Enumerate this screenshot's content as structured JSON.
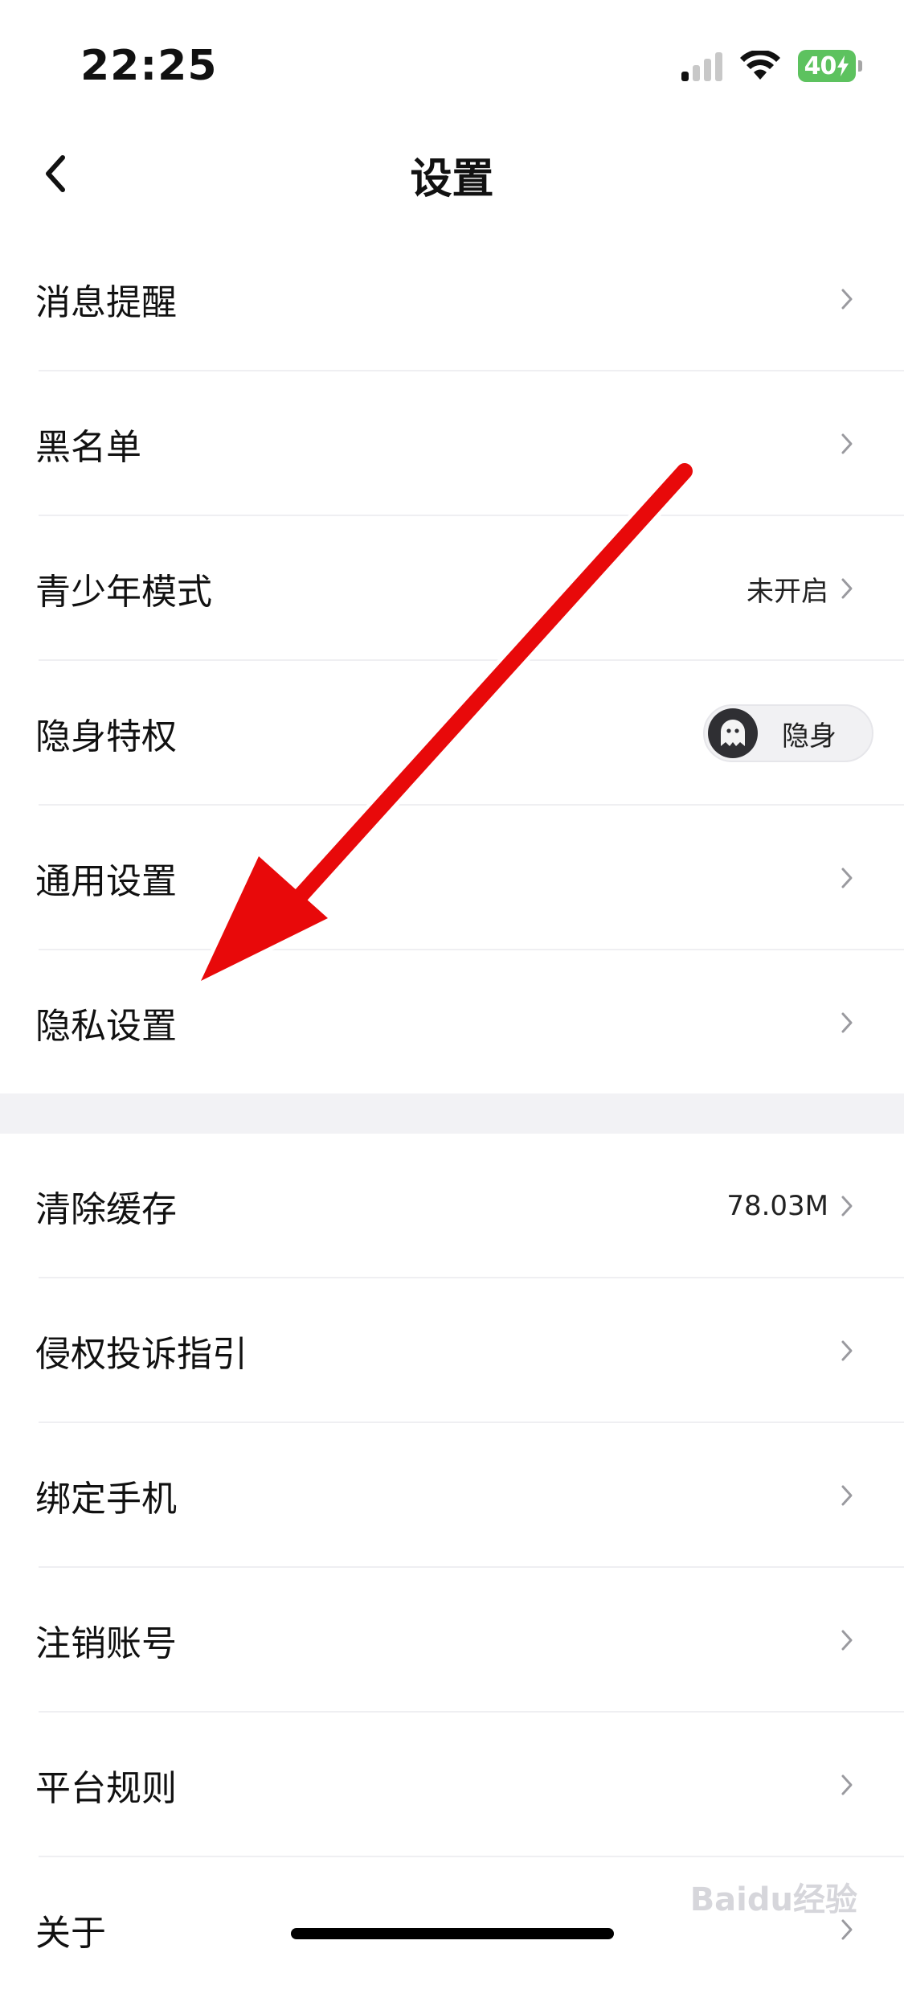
{
  "status_bar": {
    "time": "22:25",
    "battery": "40",
    "signal_bars_active": 1,
    "signal_bars_total": 4,
    "wifi_icon": "wifi-icon"
  },
  "nav": {
    "title": "设置",
    "back_icon": "chevron-left-icon"
  },
  "group1": [
    {
      "label": "消息提醒",
      "value": ""
    },
    {
      "label": "黑名单",
      "value": ""
    },
    {
      "label": "青少年模式",
      "value": "未开启"
    },
    {
      "label": "隐身特权",
      "toggle_label": "隐身"
    },
    {
      "label": "通用设置",
      "value": ""
    },
    {
      "label": "隐私设置",
      "value": ""
    }
  ],
  "group2": [
    {
      "label": "清除缓存",
      "value": "78.03M"
    },
    {
      "label": "侵权投诉指引",
      "value": ""
    },
    {
      "label": "绑定手机",
      "value": ""
    },
    {
      "label": "注销账号",
      "value": ""
    },
    {
      "label": "平台规则",
      "value": ""
    },
    {
      "label": "关于",
      "value": ""
    }
  ],
  "watermark": "Baidu经验",
  "colors": {
    "annotation_arrow": "#e8090a",
    "battery": "#5dc25f",
    "section_background": "#f2f2f5"
  }
}
